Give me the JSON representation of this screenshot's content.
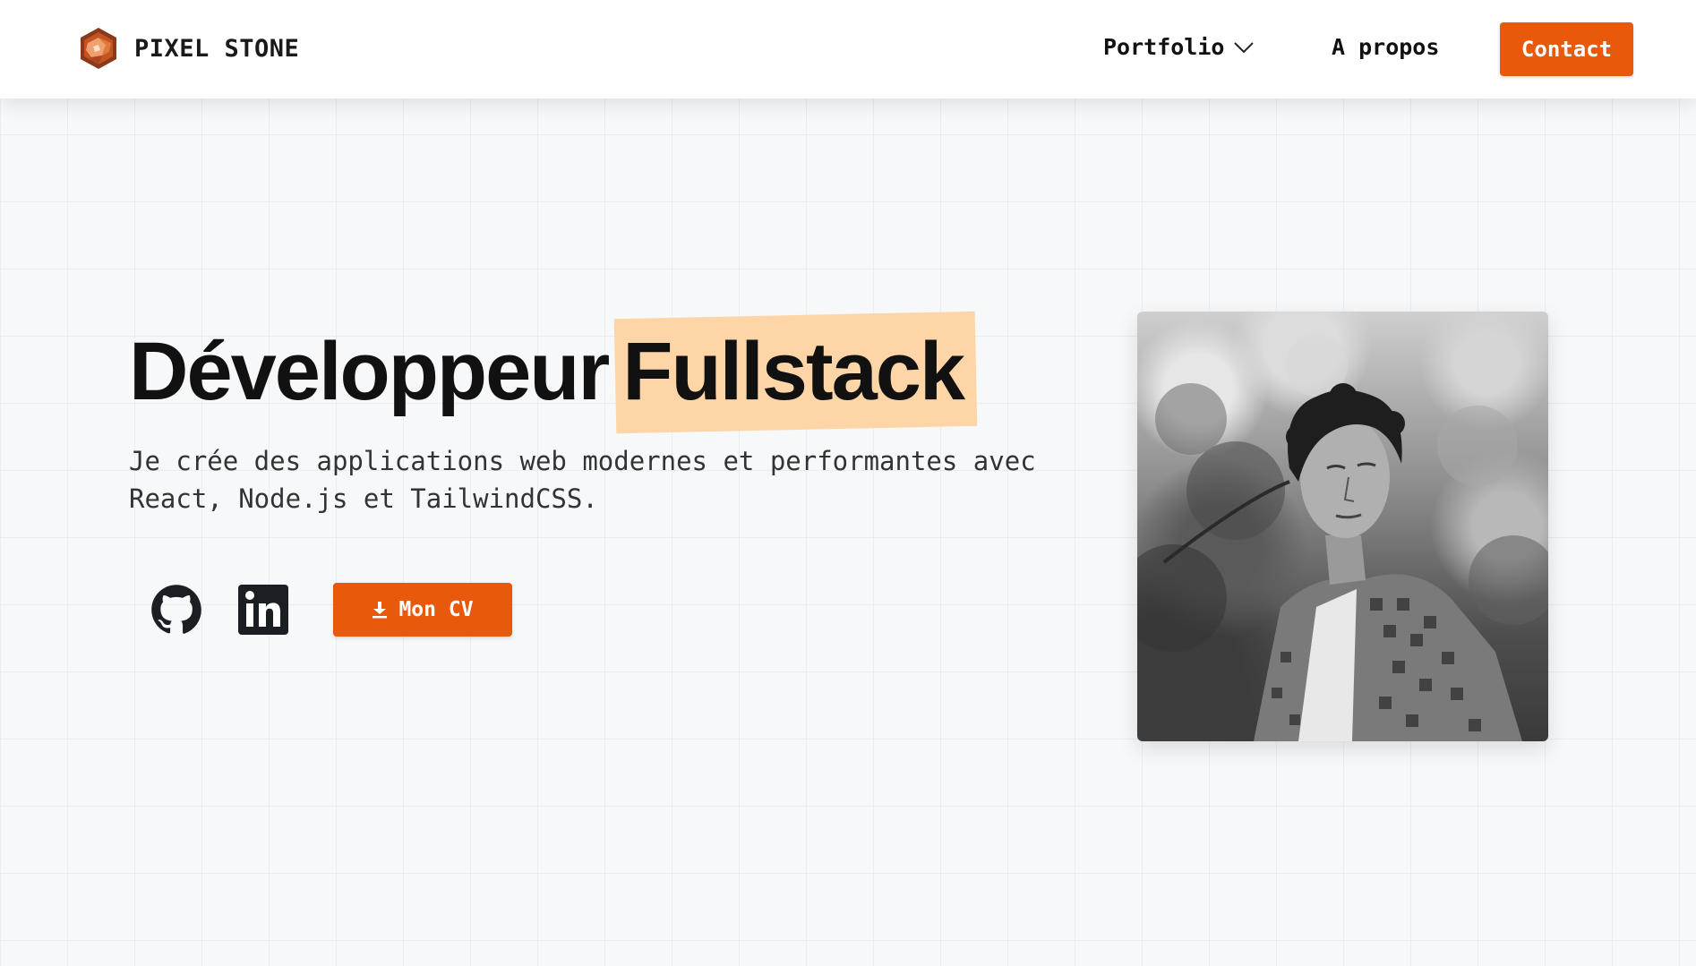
{
  "brand": {
    "name": "PIXEL STONE",
    "accent": "#e8590c"
  },
  "nav": {
    "portfolio_label": "Portfolio",
    "apropos_label": "A propos",
    "contact_label": "Contact"
  },
  "hero": {
    "title_part1": "Développeur",
    "title_highlight": "Fullstack",
    "highlight_color": "#fdd5a6",
    "subtitle": "Je crée des applications web modernes et performantes avec React, Node.js et TailwindCSS.",
    "cv_label": "Mon CV"
  },
  "icons": [
    "logo-icon",
    "chevron-down-icon",
    "github-icon",
    "linkedin-icon",
    "download-icon"
  ]
}
